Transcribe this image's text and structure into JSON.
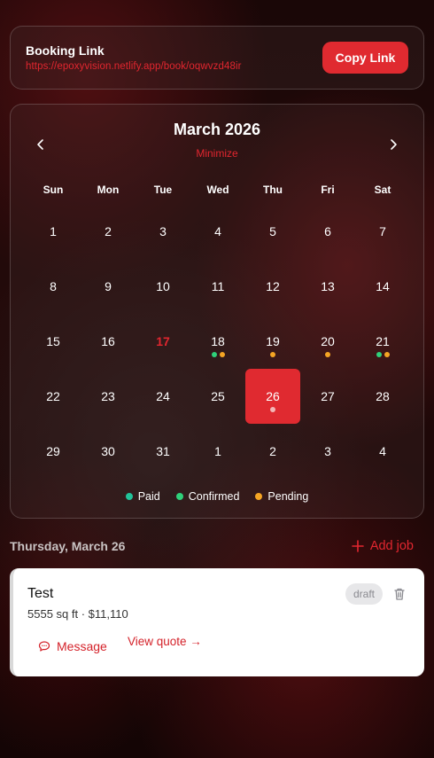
{
  "booking": {
    "title": "Booking Link",
    "url": "https://epoxyvision.netlify.app/book/oqwvzd48ir",
    "copy_label": "Copy Link"
  },
  "calendar": {
    "month_label": "March 2026",
    "minimize_label": "Minimize",
    "weekdays": [
      "Sun",
      "Mon",
      "Tue",
      "Wed",
      "Thu",
      "Fri",
      "Sat"
    ],
    "days": [
      {
        "label": "1"
      },
      {
        "label": "2"
      },
      {
        "label": "3"
      },
      {
        "label": "4"
      },
      {
        "label": "5"
      },
      {
        "label": "6"
      },
      {
        "label": "7"
      },
      {
        "label": "8"
      },
      {
        "label": "9"
      },
      {
        "label": "10"
      },
      {
        "label": "11"
      },
      {
        "label": "12"
      },
      {
        "label": "13"
      },
      {
        "label": "14"
      },
      {
        "label": "15"
      },
      {
        "label": "16"
      },
      {
        "label": "17",
        "today": true
      },
      {
        "label": "18",
        "dots": [
          "confirmed",
          "pending"
        ]
      },
      {
        "label": "19",
        "dots": [
          "pending"
        ]
      },
      {
        "label": "20",
        "dots": [
          "pending"
        ]
      },
      {
        "label": "21",
        "dots": [
          "confirmed",
          "pending"
        ]
      },
      {
        "label": "22"
      },
      {
        "label": "23"
      },
      {
        "label": "24"
      },
      {
        "label": "25"
      },
      {
        "label": "26",
        "selected": true,
        "dots": [
          "draft"
        ]
      },
      {
        "label": "27"
      },
      {
        "label": "28"
      },
      {
        "label": "29"
      },
      {
        "label": "30"
      },
      {
        "label": "31"
      },
      {
        "label": "1"
      },
      {
        "label": "2"
      },
      {
        "label": "3"
      },
      {
        "label": "4"
      }
    ],
    "legend": [
      {
        "label": "Paid",
        "color": "#22c39a"
      },
      {
        "label": "Confirmed",
        "color": "#2fd17a"
      },
      {
        "label": "Pending",
        "color": "#f5a524"
      }
    ],
    "dot_colors": {
      "paid": "#22c39a",
      "confirmed": "#2fd17a",
      "pending": "#f5a524",
      "draft": "#f3b6b6"
    }
  },
  "selected_day": {
    "title": "Thursday, March 26",
    "add_job_label": "Add job"
  },
  "job": {
    "title": "Test",
    "meta": "5555 sq ft · $11,110",
    "status": "draft",
    "message_label": "Message",
    "view_quote_label": "View quote →"
  },
  "colors": {
    "accent": "#e02a30"
  }
}
